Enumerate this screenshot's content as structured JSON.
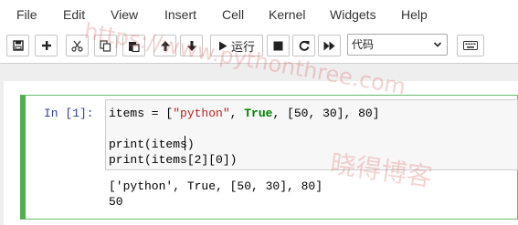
{
  "menu": {
    "items": [
      "File",
      "Edit",
      "View",
      "Insert",
      "Cell",
      "Kernel",
      "Widgets",
      "Help"
    ]
  },
  "toolbar": {
    "save_icon": "save-icon",
    "add_icon": "plus-icon",
    "cut_icon": "scissors-icon",
    "copy_icon": "copy-icon",
    "paste_icon": "paste-icon",
    "up_icon": "arrow-up-icon",
    "down_icon": "arrow-down-icon",
    "run_label": "运行",
    "stop_icon": "stop-icon",
    "restart_icon": "restart-icon",
    "fastforward_icon": "fast-forward-icon",
    "cell_type": "代码",
    "keyboard_icon": "keyboard-icon"
  },
  "cell": {
    "prompt": "In  [1]:",
    "code": {
      "line1_a": "items = [",
      "line1_str": "\"python\"",
      "line1_b": ", ",
      "line1_kw": "True",
      "line1_c": ", [50, 30], 80]",
      "line3": "print(items)",
      "line4": "print(items[2][0])"
    },
    "output": [
      "['python', True, [50, 30], 80]",
      "50"
    ]
  },
  "watermark": {
    "url": "https://www.pythonthree.com",
    "cn": "晓得博客"
  },
  "colors": {
    "cell_border": "#66bb6a",
    "prompt": "#303f9f",
    "keyword": "#008000",
    "string": "#ba2121"
  }
}
